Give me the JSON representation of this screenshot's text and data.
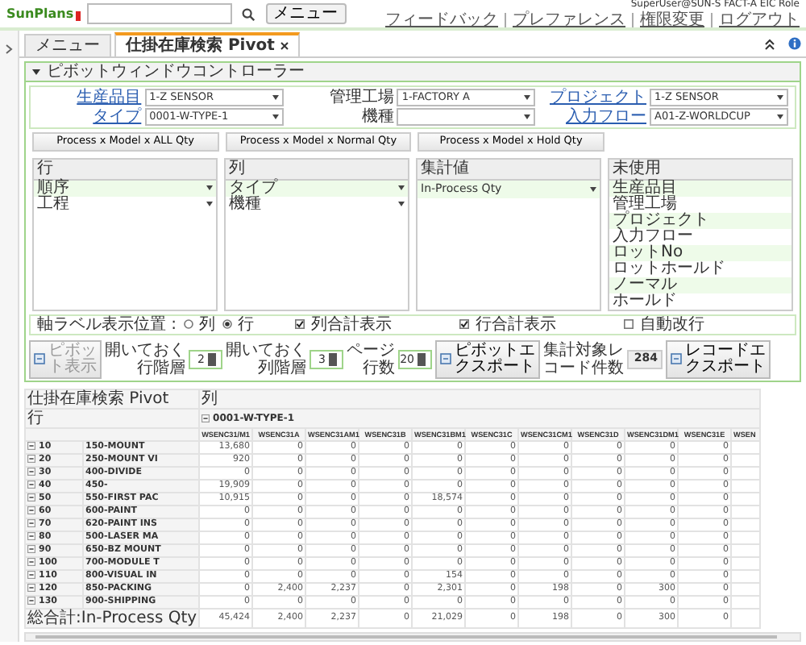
{
  "header": {
    "logo": "SunPlans",
    "menu_button": "メニュー",
    "user": "SuperUser@SUN-S FACT-A EIC Role",
    "links": [
      "フィードバック",
      "プレファレンス",
      "権限変更",
      "ログアウト"
    ]
  },
  "tabs": [
    {
      "label": "メニュー",
      "selected": false,
      "closable": false
    },
    {
      "label": "仕掛在庫検索 Pivot",
      "selected": true,
      "closable": true
    }
  ],
  "panel": {
    "title": "ピボットウィンドウコントローラー",
    "expanded": true
  },
  "filters": [
    {
      "label": "生産品目",
      "link": true,
      "value": "1-Z SENSOR"
    },
    {
      "label": "管理工場",
      "link": false,
      "value": "1-FACTORY A"
    },
    {
      "label": "プロジェクト",
      "link": true,
      "value": "1-Z SENSOR"
    },
    {
      "label": "タイプ",
      "link": true,
      "value": "0001-W-TYPE-1"
    },
    {
      "label": "機種",
      "link": false
    },
    {
      "label": "入力フロー",
      "link": true,
      "value": "A01-Z-WORLDCUP"
    }
  ],
  "presets": [
    "Process x Model x ALL Qty",
    "Process x Model x Normal Qty",
    "Process x Model x Hold Qty"
  ],
  "lists": [
    {
      "title": "行",
      "kind": "dropdown",
      "items": [
        "順序",
        "工程"
      ]
    },
    {
      "title": "列",
      "kind": "dropdown",
      "items": [
        "タイプ",
        "機種"
      ]
    },
    {
      "title": "集計値",
      "kind": "dropdown",
      "items": [
        "In-Process Qty"
      ]
    },
    {
      "title": "未使用",
      "kind": "plain",
      "items": [
        "生産品目",
        "管理工場",
        "プロジェクト",
        "入力フロー",
        "ロットNo",
        "ロットホールド",
        "ノーマル",
        "ホールド"
      ]
    }
  ],
  "options": [
    {
      "kind": "radio",
      "label": "軸ラベル表示位置 :",
      "choices": [
        {
          "label": "列",
          "selected": false
        },
        {
          "label": "行",
          "selected": true
        }
      ]
    },
    {
      "kind": "checkbox",
      "label": "列合計表示",
      "checked": true
    },
    {
      "kind": "checkbox",
      "label": "行合計表示",
      "checked": true
    },
    {
      "kind": "checkbox",
      "label": "自動改行",
      "checked": false
    }
  ],
  "controls": [
    {
      "kind": "button",
      "label": "ピボット表示",
      "disabled": true
    },
    {
      "kind": "spinner",
      "label": "開いておく行階層",
      "value": "2"
    },
    {
      "kind": "spinner",
      "label": "開いておく列階層",
      "value": "3"
    },
    {
      "kind": "spinner",
      "label": "ページ行数",
      "value": "20"
    },
    {
      "kind": "button",
      "label": "ピボットエクスポート",
      "disabled": false
    },
    {
      "kind": "readout",
      "label": "集計対象レコード件数",
      "value": "284"
    },
    {
      "kind": "button",
      "label": "レコードエクスポート",
      "disabled": false
    }
  ],
  "pivot": {
    "title": "仕掛在庫検索 Pivot",
    "column_axis": "列",
    "row_axis": "行",
    "column_group": {
      "label": "0001-W-TYPE-1",
      "expanded": true
    },
    "columns": [
      "WSENC31/M1",
      "WSENC31A",
      "WSENC31AM1",
      "WSENC31B",
      "WSENC31BM1",
      "WSENC31C",
      "WSENC31CM1",
      "WSENC31D",
      "WSENC31DM1",
      "WSENC31E",
      "WSEN"
    ],
    "rows": [
      {
        "order": "10",
        "process": "150-MOUNT",
        "expanded": true,
        "values": [
          "13,680",
          "0",
          "0",
          "0",
          "0",
          "0",
          "0",
          "0",
          "0",
          "0"
        ]
      },
      {
        "order": "20",
        "process": "250-MOUNT VI",
        "expanded": true,
        "values": [
          "920",
          "0",
          "0",
          "0",
          "0",
          "0",
          "0",
          "0",
          "0",
          "0"
        ]
      },
      {
        "order": "30",
        "process": "400-DIVIDE",
        "expanded": true,
        "values": [
          "0",
          "0",
          "0",
          "0",
          "0",
          "0",
          "0",
          "0",
          "0",
          "0"
        ]
      },
      {
        "order": "40",
        "process": "450-",
        "expanded": true,
        "values": [
          "19,909",
          "0",
          "0",
          "0",
          "0",
          "0",
          "0",
          "0",
          "0",
          "0"
        ]
      },
      {
        "order": "50",
        "process": "550-FIRST PAC",
        "expanded": true,
        "values": [
          "10,915",
          "0",
          "0",
          "0",
          "18,574",
          "0",
          "0",
          "0",
          "0",
          "0"
        ]
      },
      {
        "order": "60",
        "process": "600-PAINT",
        "expanded": true,
        "values": [
          "0",
          "0",
          "0",
          "0",
          "0",
          "0",
          "0",
          "0",
          "0",
          "0"
        ]
      },
      {
        "order": "70",
        "process": "620-PAINT INS",
        "expanded": true,
        "values": [
          "0",
          "0",
          "0",
          "0",
          "0",
          "0",
          "0",
          "0",
          "0",
          "0"
        ]
      },
      {
        "order": "80",
        "process": "500-LASER MA",
        "expanded": true,
        "values": [
          "0",
          "0",
          "0",
          "0",
          "0",
          "0",
          "0",
          "0",
          "0",
          "0"
        ]
      },
      {
        "order": "90",
        "process": "650-BZ MOUNT",
        "expanded": true,
        "values": [
          "0",
          "0",
          "0",
          "0",
          "0",
          "0",
          "0",
          "0",
          "0",
          "0"
        ]
      },
      {
        "order": "100",
        "process": "700-MODULE T",
        "expanded": true,
        "values": [
          "0",
          "0",
          "0",
          "0",
          "0",
          "0",
          "0",
          "0",
          "0",
          "0"
        ]
      },
      {
        "order": "110",
        "process": "800-VISUAL IN",
        "expanded": true,
        "values": [
          "0",
          "0",
          "0",
          "0",
          "154",
          "0",
          "0",
          "0",
          "0",
          "0"
        ]
      },
      {
        "order": "120",
        "process": "850-PACKING",
        "expanded": true,
        "values": [
          "0",
          "2,400",
          "2,237",
          "0",
          "2,301",
          "0",
          "198",
          "0",
          "300",
          "0"
        ]
      },
      {
        "order": "130",
        "process": "900-SHIPPING",
        "expanded": true,
        "values": [
          "0",
          "0",
          "0",
          "0",
          "0",
          "0",
          "0",
          "0",
          "0",
          "0"
        ]
      }
    ],
    "total": {
      "label": "総合計:In-Process Qty",
      "values": [
        "45,424",
        "2,400",
        "2,237",
        "0",
        "21,029",
        "0",
        "198",
        "0",
        "300",
        "0"
      ]
    }
  }
}
